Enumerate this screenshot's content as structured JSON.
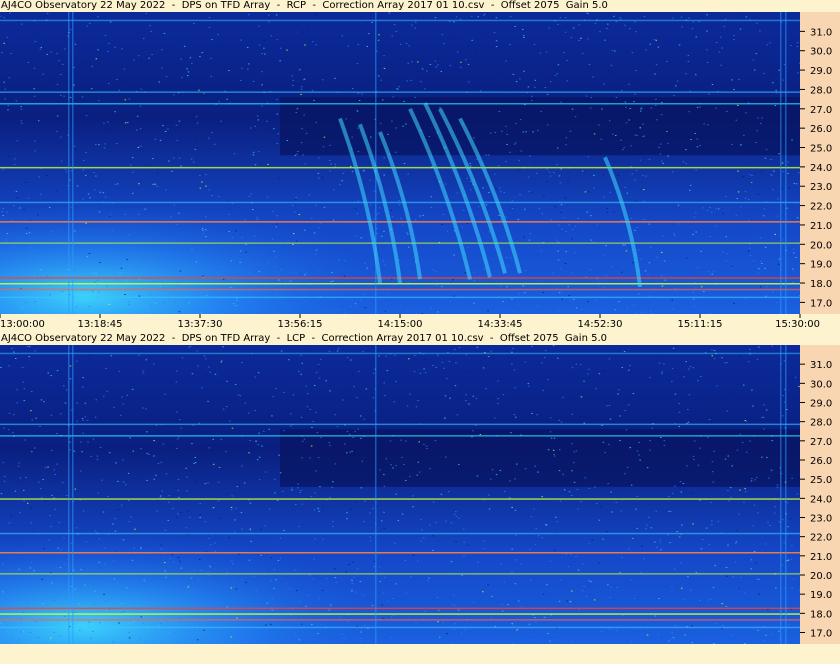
{
  "chart_data": [
    {
      "type": "heatmap",
      "title": "AJ4CO Observatory 22 May 2022  -  DPS on TFD Array  -  RCP  -  Correction Array 2017 01 10.csv  -  Offset 2075  Gain 5.0",
      "ylim": [
        16.4,
        32.0
      ],
      "yticks": [
        "31.0",
        "30.0",
        "29.0",
        "28.0",
        "27.0",
        "26.0",
        "25.0",
        "24.0",
        "23.0",
        "22.0",
        "21.0",
        "20.0",
        "19.0",
        "18.0",
        "17.0"
      ],
      "xticks": [
        "13:00:00",
        "13:18:45",
        "13:37:30",
        "13:56:15",
        "14:15:00",
        "14:33:45",
        "14:52:30",
        "15:11:15",
        "15:30:00"
      ],
      "colors": {
        "low": "#0a1a6e",
        "mid": "#1e6cff",
        "high": "#2ad8ff",
        "peak": "#c8ff30",
        "hot": "#ff4020"
      }
    },
    {
      "type": "heatmap",
      "title": "AJ4CO Observatory 22 May 2022  -  DPS on TFD Array  -  LCP  -  Correction Array 2017 01 10.csv  -  Offset 2075  Gain 5.0",
      "ylim": [
        16.4,
        32.0
      ],
      "yticks": [
        "31.0",
        "30.0",
        "29.0",
        "28.0",
        "27.0",
        "26.0",
        "25.0",
        "24.0",
        "23.0",
        "22.0",
        "21.0",
        "20.0",
        "19.0",
        "18.0",
        "17.0"
      ],
      "colors": {
        "low": "#0a1a6e",
        "mid": "#1e6cff",
        "high": "#2ad8ff",
        "peak": "#c8ff30",
        "hot": "#ff4020"
      }
    }
  ]
}
